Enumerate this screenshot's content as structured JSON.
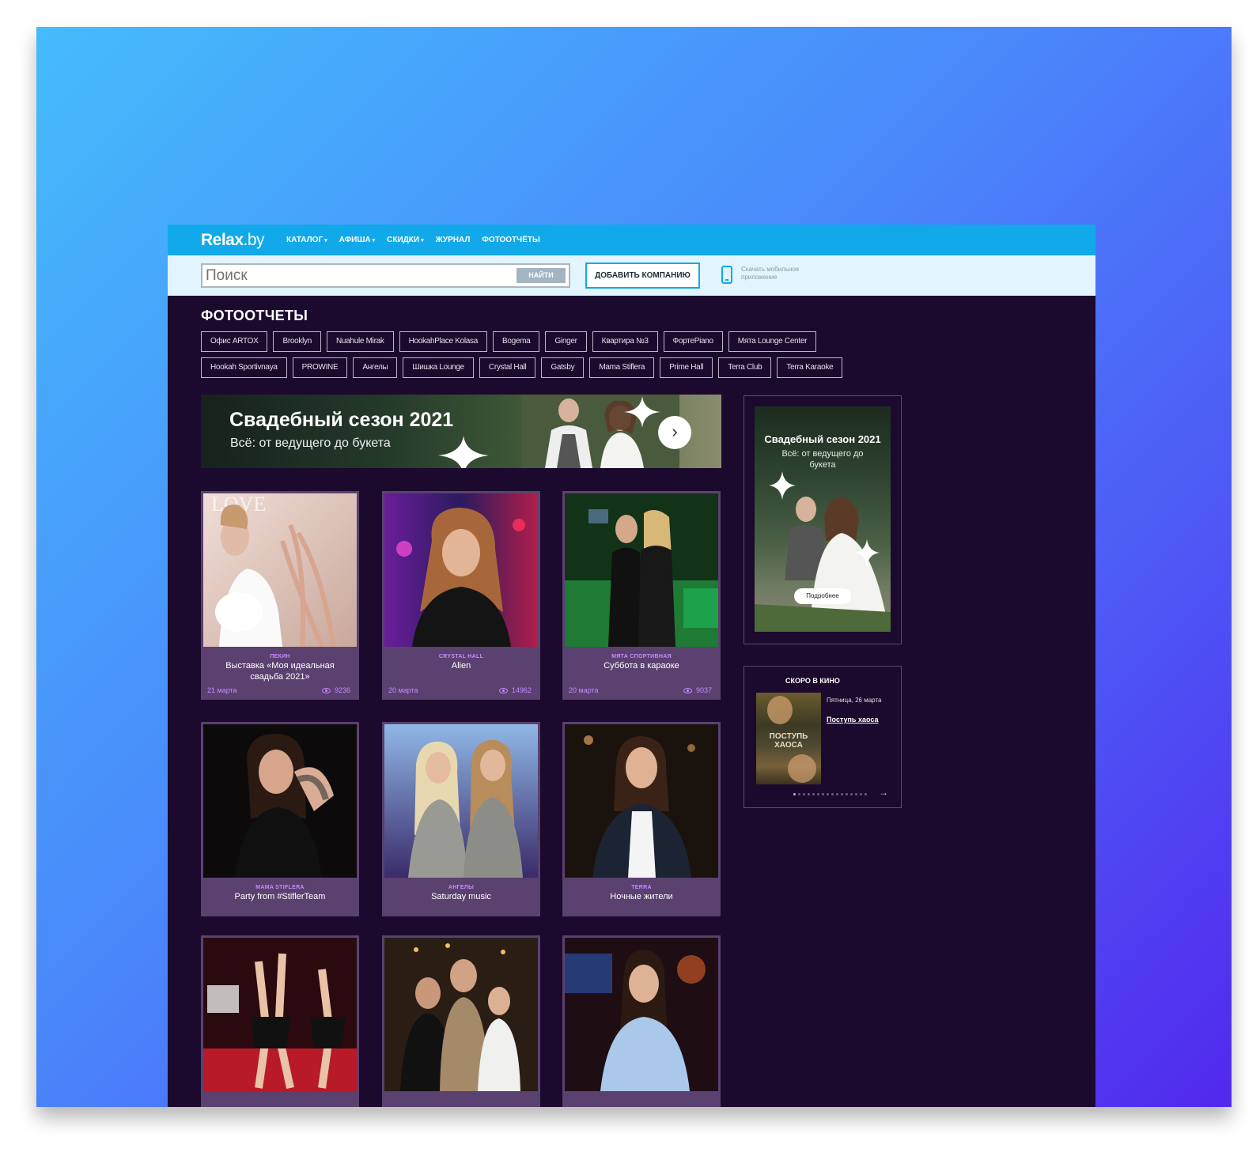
{
  "header": {
    "logo_main": "Relax",
    "logo_tld": ".by",
    "nav": [
      {
        "label": "КАТАЛОГ",
        "dropdown": true
      },
      {
        "label": "АФИША",
        "dropdown": true
      },
      {
        "label": "СКИДКИ",
        "dropdown": true
      },
      {
        "label": "ЖУРНАЛ",
        "dropdown": false
      },
      {
        "label": "ФОТООТЧЁТЫ",
        "dropdown": false
      }
    ]
  },
  "search": {
    "placeholder": "Поиск",
    "button_label": "НАЙТИ",
    "add_company_label": "ДОБАВИТЬ КОМПАНИЮ",
    "app_text": "Скачать мобильное приложение"
  },
  "main": {
    "title": "ФОТООТЧЕТЫ",
    "tags": [
      "Офис ARTOX",
      "Brooklyn",
      "Nuahule Mirak",
      "HookahPlace Kolasa",
      "Bogema",
      "Ginger",
      "Квартира №3",
      "ФортеPiano",
      "Мята Lounge Center",
      "Hookah Sportivnaya",
      "PROWINE",
      "Ангелы",
      "Шишка Lounge",
      "Crystal Hall",
      "Gatsby",
      "Mama Stiflera",
      "Prime Hall",
      "Terra Club",
      "Terra Karaoke"
    ],
    "banner": {
      "title": "Свадебный сезон 2021",
      "subtitle": "Всё: от ведущего до букета"
    },
    "cards": [
      {
        "venue": "ПЕКИН",
        "title": "Выставка «Моя идеальная свадьба 2021»",
        "date": "21 марта",
        "views": "9236"
      },
      {
        "venue": "CRYSTAL HALL",
        "title": "Alien",
        "date": "20 марта",
        "views": "14962"
      },
      {
        "venue": "МЯТА СПОРТИВНАЯ",
        "title": "Суббота в караоке",
        "date": "20 марта",
        "views": "9037"
      },
      {
        "venue": "MAMA STIFLERA",
        "title": "Party from #StiflerTeam",
        "date": "",
        "views": ""
      },
      {
        "venue": "АНГЕЛЫ",
        "title": "Saturday music",
        "date": "",
        "views": ""
      },
      {
        "venue": "TERRA",
        "title": "Ночные жители",
        "date": "",
        "views": ""
      }
    ]
  },
  "sidebar": {
    "ad_title": "Свадебный сезон 2021",
    "ad_subtitle": "Всё: от ведущего до букета",
    "ad_button": "Подробнее",
    "cinema_title": "СКОРО В КИНО",
    "cinema_date": "Пятница, 26 марта",
    "cinema_movie": "Поступь хаоса",
    "poster_text": "ПОСТУПЬ ХАОСА"
  },
  "colors": {
    "brand_blue": "#11a9ea",
    "page_bg": "#1b0a2d",
    "card_bg": "#5a416f",
    "accent_purple": "#c78bff"
  },
  "icons": [
    "chevron-right-icon",
    "eye-icon",
    "phone-icon",
    "sparkle-icon",
    "arrow-right-icon"
  ]
}
